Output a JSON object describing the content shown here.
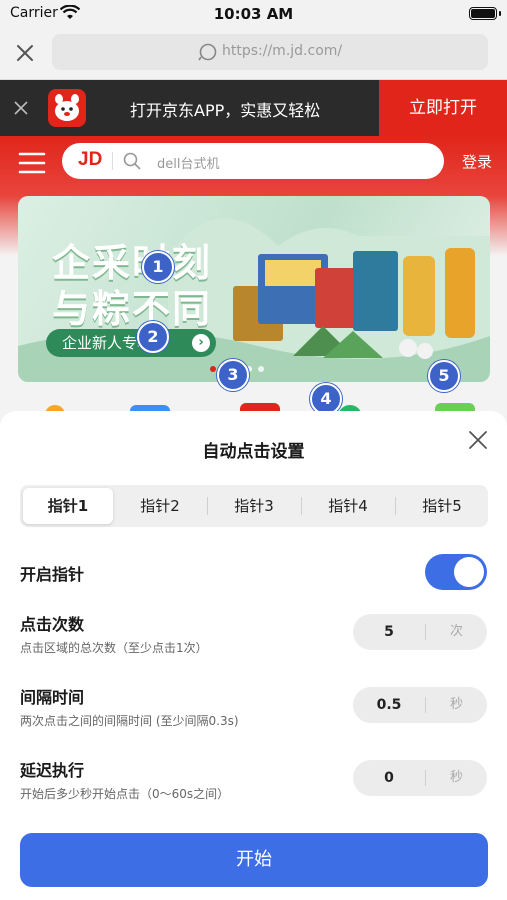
{
  "status_bar": {
    "carrier": "Carrier",
    "time": "10:03 AM"
  },
  "browser": {
    "url": "https://m.jd.com/"
  },
  "app_banner": {
    "text": "打开京东APP，实惠又轻松",
    "open_label": "立即打开"
  },
  "jd_header": {
    "logo": "JD",
    "search_placeholder": "dell台式机",
    "login_label": "登录"
  },
  "carousel": {
    "title_line1": "企采时刻",
    "title_line2": "与粽不同",
    "pill_text": "企业新人专享",
    "pill_arrow": "›",
    "dots_count": 5,
    "active_dot": 0
  },
  "pointers": [
    {
      "label": "1"
    },
    {
      "label": "2"
    },
    {
      "label": "3"
    },
    {
      "label": "4"
    },
    {
      "label": "5"
    }
  ],
  "sheet": {
    "title": "自动点击设置",
    "tabs": [
      {
        "label": "指针1",
        "active": true
      },
      {
        "label": "指针2",
        "active": false
      },
      {
        "label": "指针3",
        "active": false
      },
      {
        "label": "指针4",
        "active": false
      },
      {
        "label": "指针5",
        "active": false
      }
    ],
    "enable": {
      "label": "开启指针",
      "on": true
    },
    "click_count": {
      "label": "点击次数",
      "desc": "点击区域的总次数（至少点击1次）",
      "value": "5",
      "unit": "次"
    },
    "interval": {
      "label": "间隔时间",
      "desc": "两次点击之间的间隔时间 (至少间隔0.3s)",
      "value": "0.5",
      "unit": "秒"
    },
    "delay": {
      "label": "延迟执行",
      "desc": "开始后多少秒开始点击（0～60s之间）",
      "value": "0",
      "unit": "秒"
    },
    "start_label": "开始"
  },
  "colors": {
    "jd_red": "#e1251b",
    "accent_blue": "#3d6ee6",
    "pointer_blue": "#3d63c9"
  }
}
